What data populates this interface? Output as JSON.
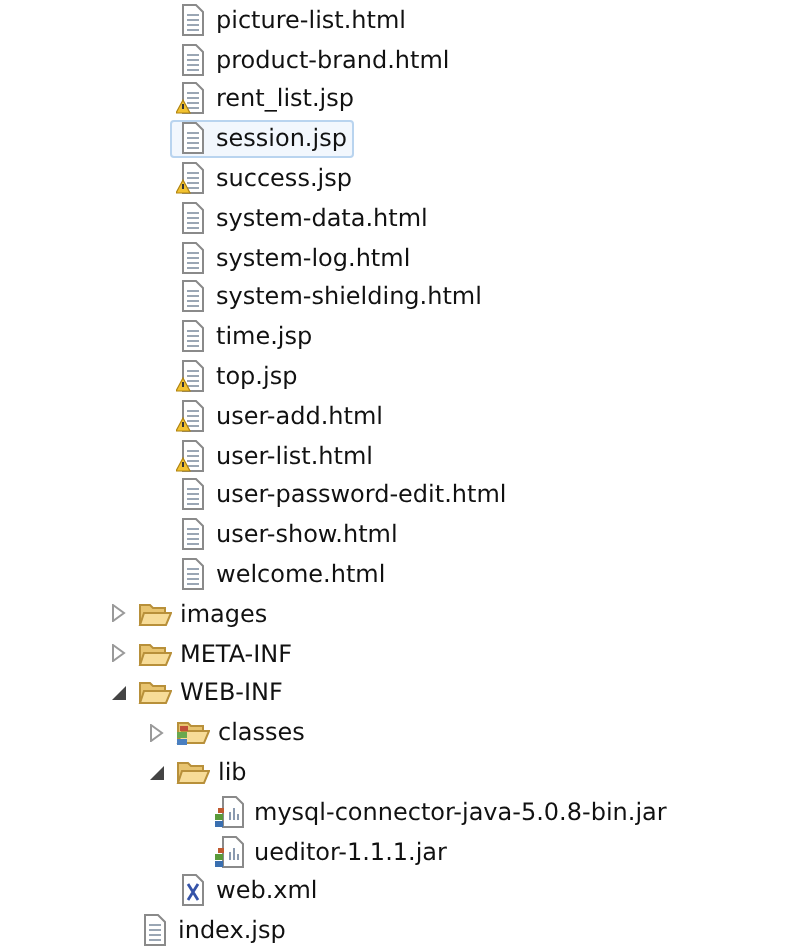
{
  "folder_files": [
    {
      "name": "picture-list.html",
      "kind": "file",
      "warning": false,
      "selected": false
    },
    {
      "name": "product-brand.html",
      "kind": "file",
      "warning": false,
      "selected": false
    },
    {
      "name": "rent_list.jsp",
      "kind": "file",
      "warning": true,
      "selected": false
    },
    {
      "name": "session.jsp",
      "kind": "file",
      "warning": false,
      "selected": true
    },
    {
      "name": "success.jsp",
      "kind": "file",
      "warning": true,
      "selected": false
    },
    {
      "name": "system-data.html",
      "kind": "file",
      "warning": false,
      "selected": false
    },
    {
      "name": "system-log.html",
      "kind": "file",
      "warning": false,
      "selected": false
    },
    {
      "name": "system-shielding.html",
      "kind": "file",
      "warning": false,
      "selected": false
    },
    {
      "name": "time.jsp",
      "kind": "file",
      "warning": false,
      "selected": false
    },
    {
      "name": "top.jsp",
      "kind": "file",
      "warning": true,
      "selected": false
    },
    {
      "name": "user-add.html",
      "kind": "file",
      "warning": true,
      "selected": false
    },
    {
      "name": "user-list.html",
      "kind": "file",
      "warning": true,
      "selected": false
    },
    {
      "name": "user-password-edit.html",
      "kind": "file",
      "warning": false,
      "selected": false
    },
    {
      "name": "user-show.html",
      "kind": "file",
      "warning": false,
      "selected": false
    },
    {
      "name": "welcome.html",
      "kind": "file",
      "warning": false,
      "selected": false
    }
  ],
  "tree": [
    {
      "name": "images",
      "kind": "folder",
      "expanded": false,
      "selected": false
    },
    {
      "name": "META-INF",
      "kind": "folder",
      "expanded": false,
      "selected": false
    },
    {
      "name": "WEB-INF",
      "kind": "folder",
      "expanded": true,
      "selected": false,
      "children": [
        {
          "name": "classes",
          "kind": "source-folder",
          "expanded": false,
          "selected": false
        },
        {
          "name": "lib",
          "kind": "folder",
          "expanded": true,
          "selected": false,
          "children": [
            {
              "name": "mysql-connector-java-5.0.8-bin.jar",
              "kind": "jar",
              "warning": false,
              "selected": false
            },
            {
              "name": "ueditor-1.1.1.jar",
              "kind": "jar",
              "warning": false,
              "selected": false
            }
          ]
        },
        {
          "name": "web.xml",
          "kind": "xml",
          "warning": false,
          "selected": false
        }
      ]
    },
    {
      "name": "index.jsp",
      "kind": "file",
      "warning": false,
      "selected": false
    }
  ]
}
